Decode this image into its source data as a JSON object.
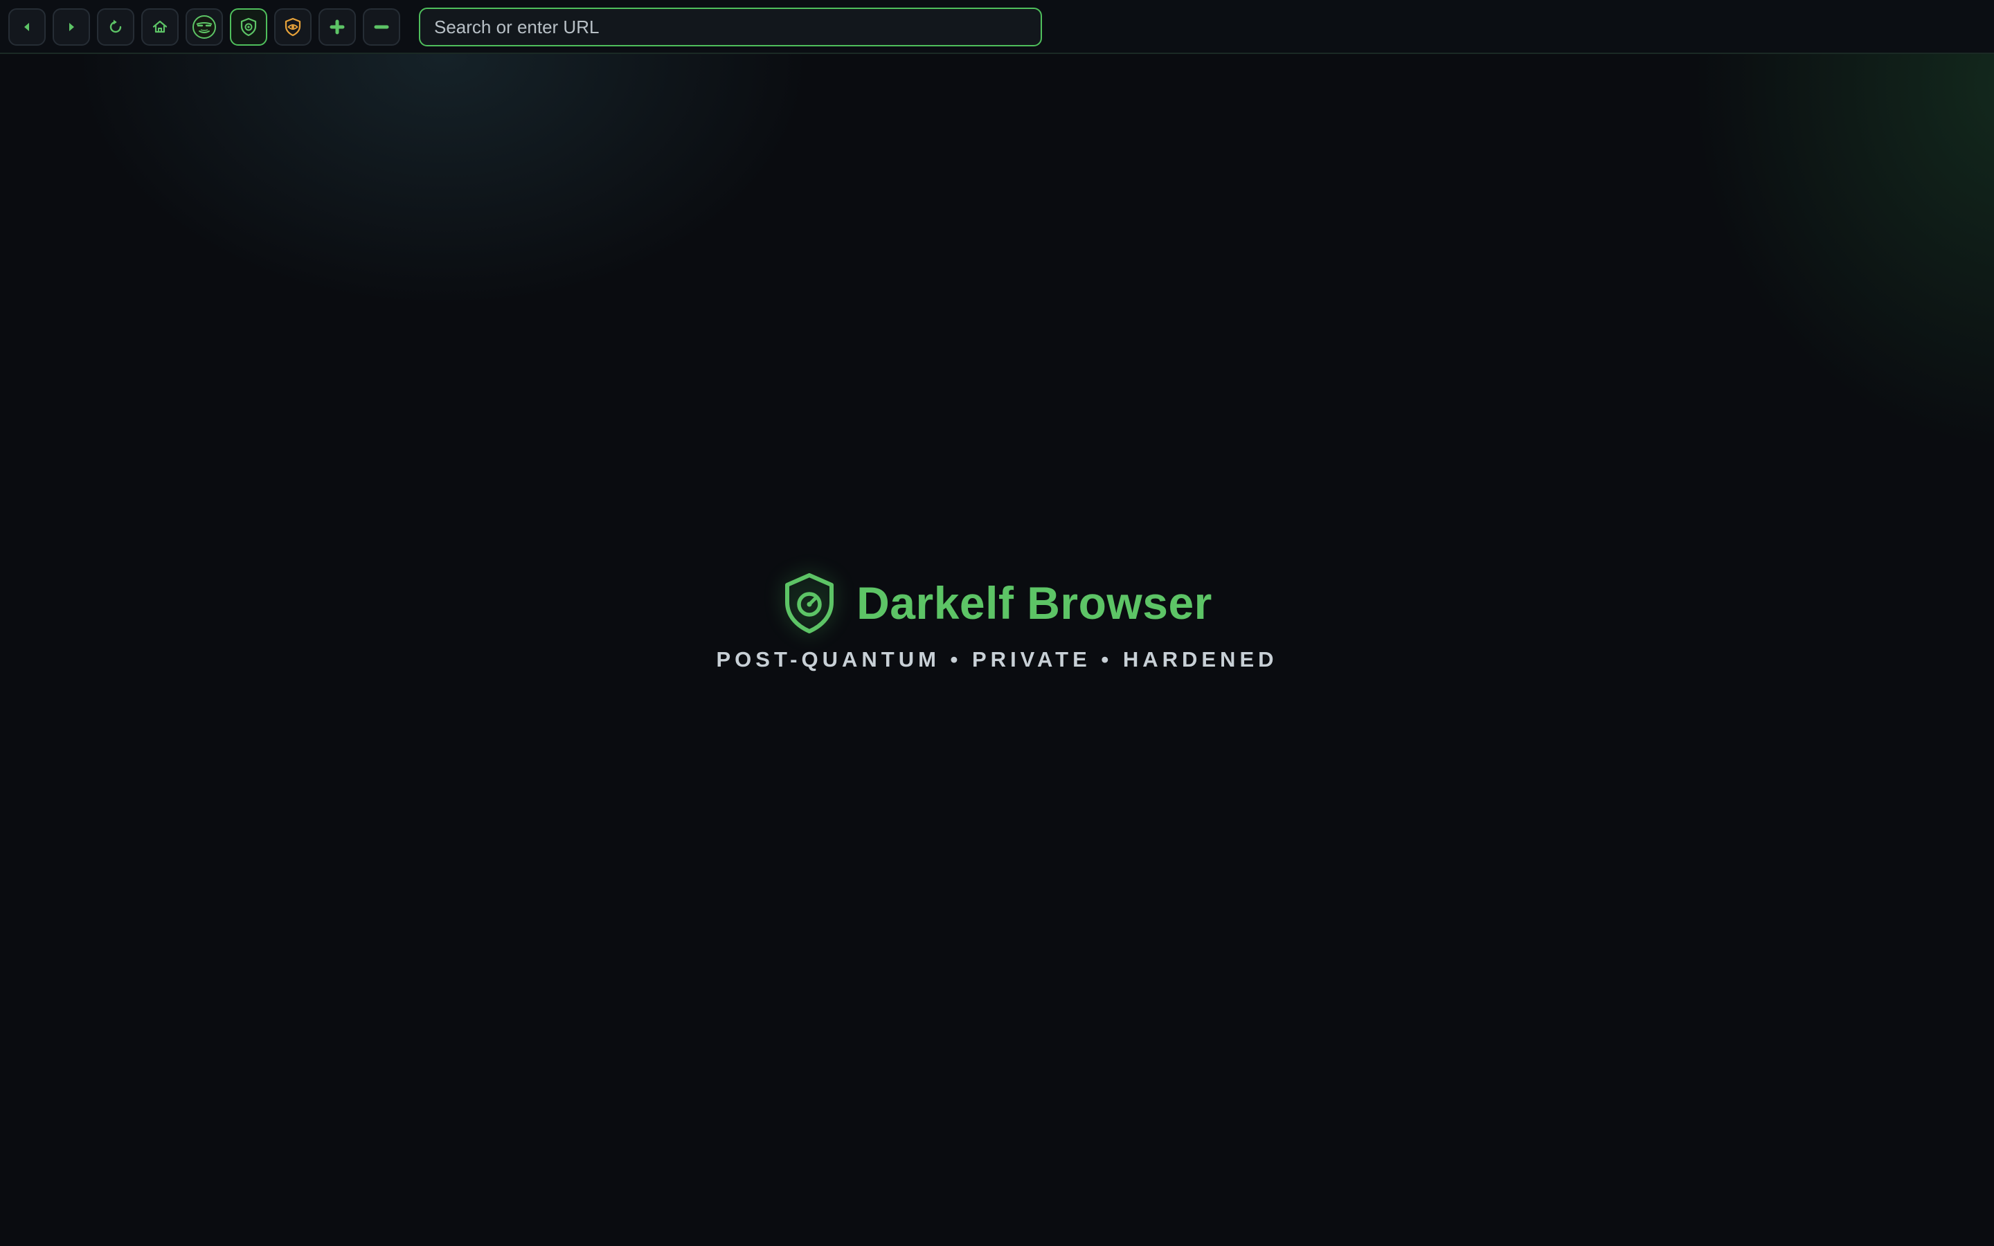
{
  "toolbar": {
    "buttons": [
      {
        "name": "back-button",
        "icon": "triangle-left-icon",
        "title": "Back"
      },
      {
        "name": "forward-button",
        "icon": "triangle-right-icon",
        "title": "Forward"
      },
      {
        "name": "reload-button",
        "icon": "reload-icon",
        "title": "Reload"
      },
      {
        "name": "home-button",
        "icon": "home-icon",
        "title": "Home"
      },
      {
        "name": "privacy-face-button",
        "icon": "masked-face-icon",
        "title": "Privacy"
      },
      {
        "name": "shield-button",
        "icon": "shield-icon",
        "title": "Protection",
        "active": true
      },
      {
        "name": "tracker-shield-button",
        "icon": "eye-shield-icon",
        "title": "Trackers"
      },
      {
        "name": "zoom-in-button",
        "icon": "plus-icon",
        "title": "Zoom in"
      },
      {
        "name": "zoom-out-button",
        "icon": "minus-icon",
        "title": "Zoom out"
      }
    ],
    "url_placeholder": "Search or enter URL",
    "url_value": ""
  },
  "hero": {
    "logo_icon": "shield-gauge-icon",
    "title": "Darkelf Browser",
    "tagline": "POST-QUANTUM • PRIVATE • HARDENED"
  },
  "colors": {
    "accent": "#5dc466",
    "accent_border": "#4fbf5c",
    "warning": "#e8a33a",
    "background": "#0a0c10",
    "tagline_text": "#c8d0d6"
  }
}
